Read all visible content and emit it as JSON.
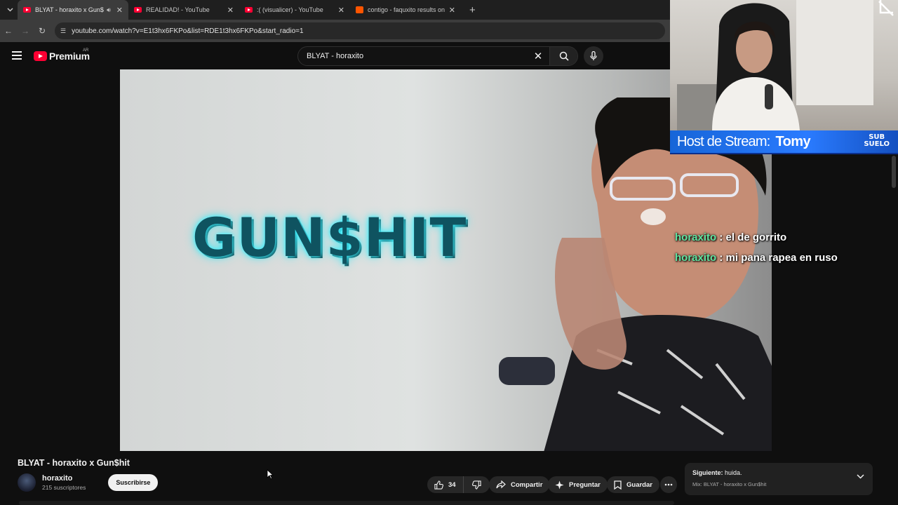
{
  "browser": {
    "tabs": [
      {
        "title": "BLYAT - horaxito x Gun$hit",
        "icon": "youtube-favicon",
        "active": true,
        "audio": true
      },
      {
        "title": "REALIDAD! - YouTube",
        "icon": "youtube-favicon",
        "active": false
      },
      {
        "title": ":( (visualicer) - YouTube",
        "icon": "youtube-favicon",
        "active": false
      },
      {
        "title": "contigo - faquxito results on So",
        "icon": "soundcloud-favicon",
        "active": false
      }
    ],
    "url": "youtube.com/watch?v=E1t3hx6FKPo&list=RDE1t3hx6FKPo&start_radio=1"
  },
  "youtube": {
    "logo_text": "Premium",
    "country_code": "AR",
    "search_query": "BLYAT - horaxito",
    "video_overlay_text": "GUN$HIT",
    "video_title": "BLYAT - horaxito x Gun$hit",
    "channel_name": "horaxito",
    "subscribers": "215 suscriptores",
    "subscribe_label": "Suscribirse",
    "like_count": "34",
    "share_label": "Compartir",
    "ask_label": "Preguntar",
    "save_label": "Guardar",
    "next_label": "Siguiente:",
    "next_title": "huida.",
    "mix_title": "Mix: BLYAT - horaxito x Gun$hit"
  },
  "stream": {
    "host_label": "Host de Stream:",
    "host_name": "Tomy",
    "logo_line1": "SUB",
    "logo_line2": "SUELO",
    "chat": [
      {
        "user": "horaxito",
        "text": ": el de gorrito"
      },
      {
        "user": "horaxito",
        "text": ": mi pana rapea en ruso"
      }
    ]
  },
  "colors": {
    "youtube_red": "#ff0033",
    "chat_user": "#5fe3a0",
    "host_bar": "#2a7bff",
    "video_text_glow": "#42f3ff"
  }
}
